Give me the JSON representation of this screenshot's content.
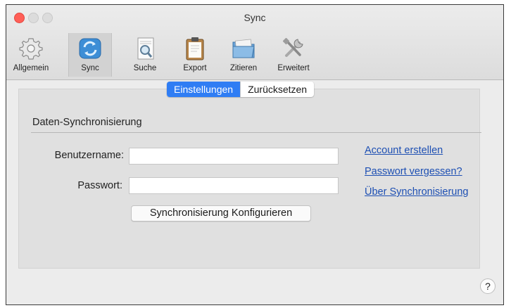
{
  "window": {
    "title": "Sync"
  },
  "toolbar": {
    "items": [
      {
        "label": "Allgemein",
        "icon": "gear-icon"
      },
      {
        "label": "Sync",
        "icon": "sync-icon",
        "active": true
      },
      {
        "label": "Suche",
        "icon": "search-document-icon"
      },
      {
        "label": "Export",
        "icon": "clipboard-icon"
      },
      {
        "label": "Zitieren",
        "icon": "folder-icon"
      },
      {
        "label": "Erweitert",
        "icon": "tools-icon"
      }
    ]
  },
  "tabs": {
    "settings": "Einstellungen",
    "reset": "Zurücksetzen",
    "selected": "Einstellungen"
  },
  "section": {
    "title": "Daten-Synchronisierung"
  },
  "form": {
    "username_label": "Benutzername:",
    "username_value": "",
    "password_label": "Passwort:",
    "password_value": "",
    "configure_button": "Synchronisierung Konfigurieren"
  },
  "links": {
    "create_account": "Account erstellen",
    "forgot_password": "Passwort vergessen?",
    "about_sync": "Über Synchronisierung"
  },
  "help": {
    "label": "?"
  },
  "colors": {
    "accent": "#2f7df4",
    "link": "#1d4fb3",
    "close": "#ff5f57"
  }
}
